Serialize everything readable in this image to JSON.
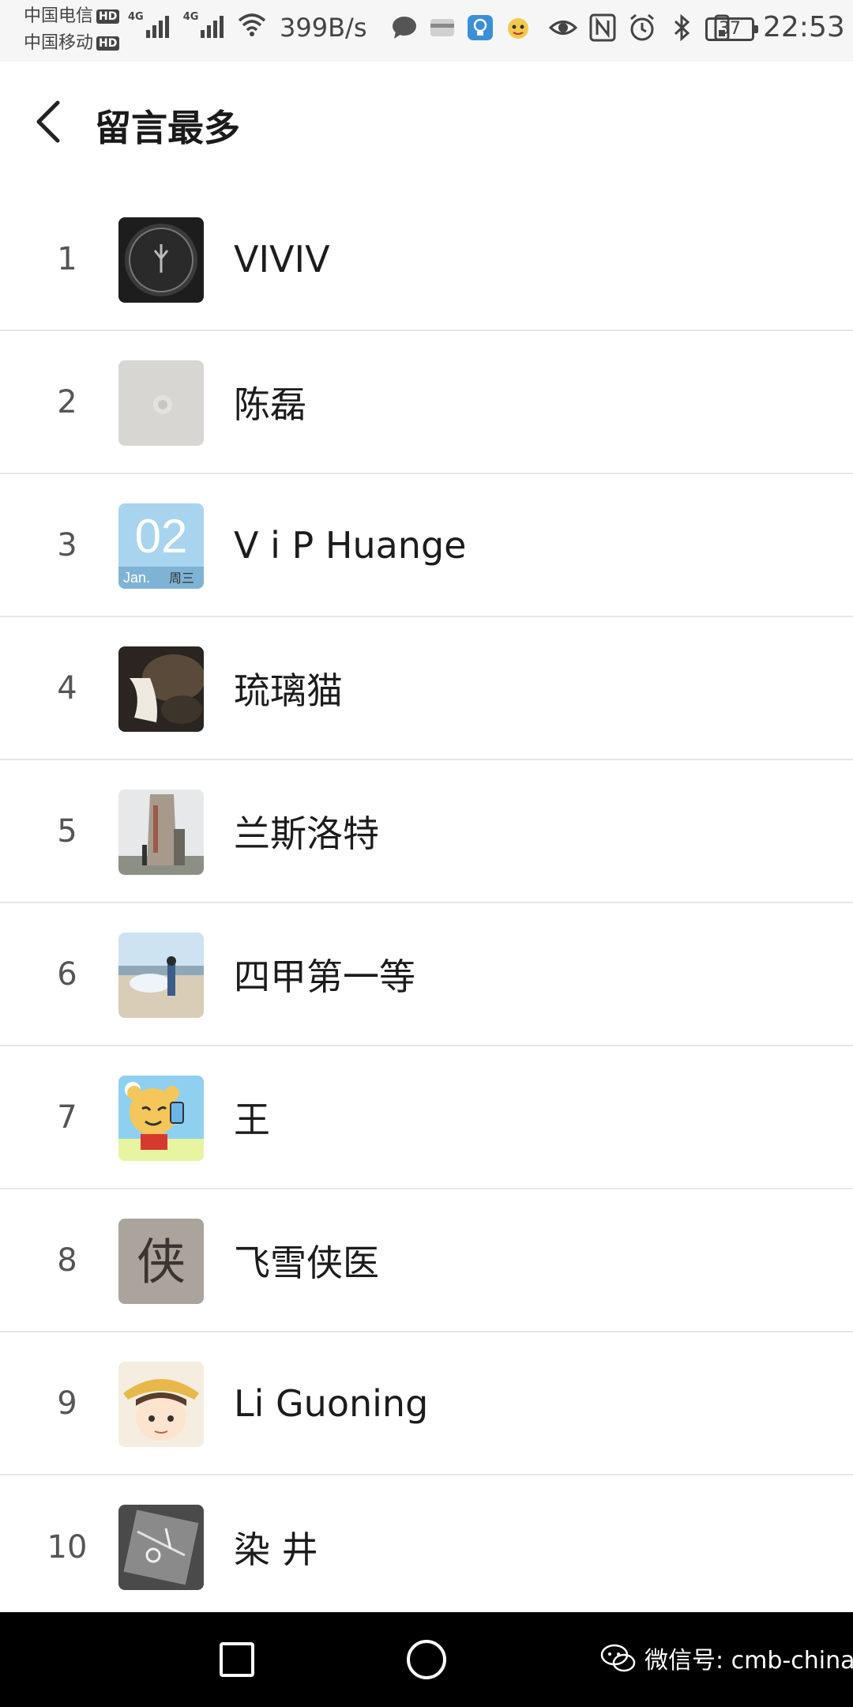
{
  "status_bar": {
    "carrier_1": "中国电信",
    "carrier_2": "中国移动",
    "hd_badge": "HD",
    "network_type": "4G",
    "net_speed": "399B/s",
    "battery_level": "37",
    "time": "22:53"
  },
  "header": {
    "title": "留言最多",
    "back_icon": "chevron-left-icon"
  },
  "list": {
    "items": [
      {
        "rank": "1",
        "name": "VIVIV"
      },
      {
        "rank": "2",
        "name": "陈磊"
      },
      {
        "rank": "3",
        "name": "V  i  P Huange"
      },
      {
        "rank": "4",
        "name": "琉璃猫"
      },
      {
        "rank": "5",
        "name": "兰斯洛特"
      },
      {
        "rank": "6",
        "name": "四甲第一等"
      },
      {
        "rank": "7",
        "name": "王"
      },
      {
        "rank": "8",
        "name": "飞雪侠医"
      },
      {
        "rank": "9",
        "name": "Li Guoning"
      },
      {
        "rank": "10",
        "name": "染 井"
      }
    ]
  },
  "avatar_3_text": {
    "day": "02",
    "month": "Jan.",
    "weekday": "周三"
  },
  "avatar_8_text": "侠",
  "nav_bar": {
    "watermark": "微信号: cmb-china"
  },
  "colors": {
    "background": "#ffffff",
    "divider": "#e6e6e6",
    "nav_bar": "#000000",
    "status_bar": "#f6f6f6"
  }
}
